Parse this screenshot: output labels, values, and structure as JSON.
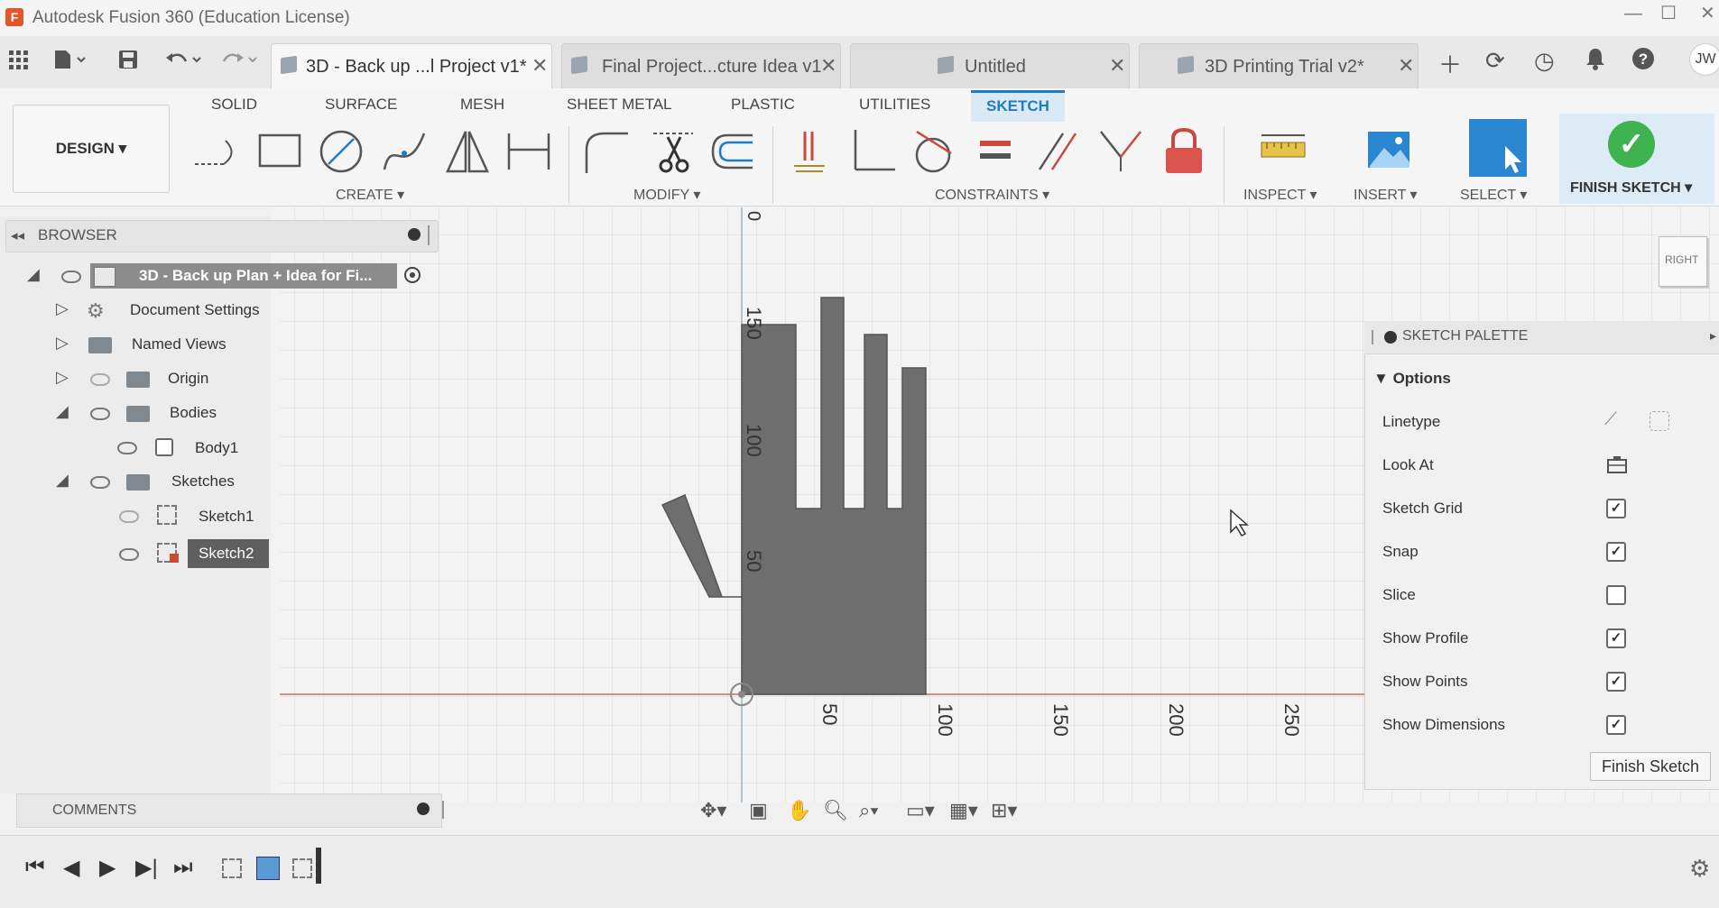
{
  "window": {
    "title": "Autodesk Fusion 360 (Education License)",
    "app_icon": "F",
    "controls": [
      "minimize-icon",
      "maximize-icon",
      "close-icon"
    ]
  },
  "quick_access": [
    "apps-grid-icon",
    "file-icon",
    "save-icon",
    "undo-icon",
    "redo-icon"
  ],
  "tabs": [
    {
      "label": "3D - Back up ...l Project v1*",
      "active": true
    },
    {
      "label": "Final Project...cture Idea v1",
      "active": false
    },
    {
      "label": "Untitled",
      "active": false
    },
    {
      "label": "3D Printing Trial v2*",
      "active": false
    }
  ],
  "right_icons": [
    "add-tab-icon",
    "sync-icon",
    "job-status-icon",
    "notifications-icon",
    "help-icon"
  ],
  "user_initials": "JW",
  "toolbar": {
    "workspace_button": "DESIGN ▾",
    "workspace_tabs": [
      "SOLID",
      "SURFACE",
      "MESH",
      "SHEET METAL",
      "PLASTIC",
      "UTILITIES",
      "SKETCH"
    ],
    "active_tab": "SKETCH",
    "groups": {
      "create": "CREATE ▾",
      "modify": "MODIFY ▾",
      "constraints": "CONSTRAINTS ▾",
      "inspect": "INSPECT ▾",
      "insert": "INSERT ▾",
      "select": "SELECT ▾",
      "finish": "FINISH SKETCH ▾"
    }
  },
  "browser": {
    "title": "BROWSER",
    "root": "3D - Back up Plan + Idea for Fi...",
    "items": [
      {
        "label": "Document Settings"
      },
      {
        "label": "Named Views"
      },
      {
        "label": "Origin"
      },
      {
        "label": "Bodies"
      },
      {
        "label": "Body1"
      },
      {
        "label": "Sketches"
      },
      {
        "label": "Sketch1"
      },
      {
        "label": "Sketch2"
      }
    ]
  },
  "viewcube": {
    "face": "RIGHT"
  },
  "canvas": {
    "x_ticks": [
      "50",
      "100",
      "150",
      "200",
      "250"
    ],
    "y_ticks": [
      "0",
      "150",
      "100",
      "50"
    ]
  },
  "sketch_palette": {
    "title": "SKETCH PALETTE",
    "section": "Options",
    "options": [
      {
        "label": "Linetype",
        "type": "icons"
      },
      {
        "label": "Look At",
        "type": "button"
      },
      {
        "label": "Sketch Grid",
        "checked": true
      },
      {
        "label": "Snap",
        "checked": true
      },
      {
        "label": "Slice",
        "checked": false
      },
      {
        "label": "Show Profile",
        "checked": true
      },
      {
        "label": "Show Points",
        "checked": true
      },
      {
        "label": "Show Dimensions",
        "checked": true
      }
    ],
    "finish_button": "Finish Sketch"
  },
  "comments": {
    "title": "COMMENTS"
  },
  "colors": {
    "sketch_fill": "#6e6e6e",
    "accent": "#1c7dc6",
    "finish_green": "#3fb34f",
    "x_axis": "#d98b8b"
  }
}
